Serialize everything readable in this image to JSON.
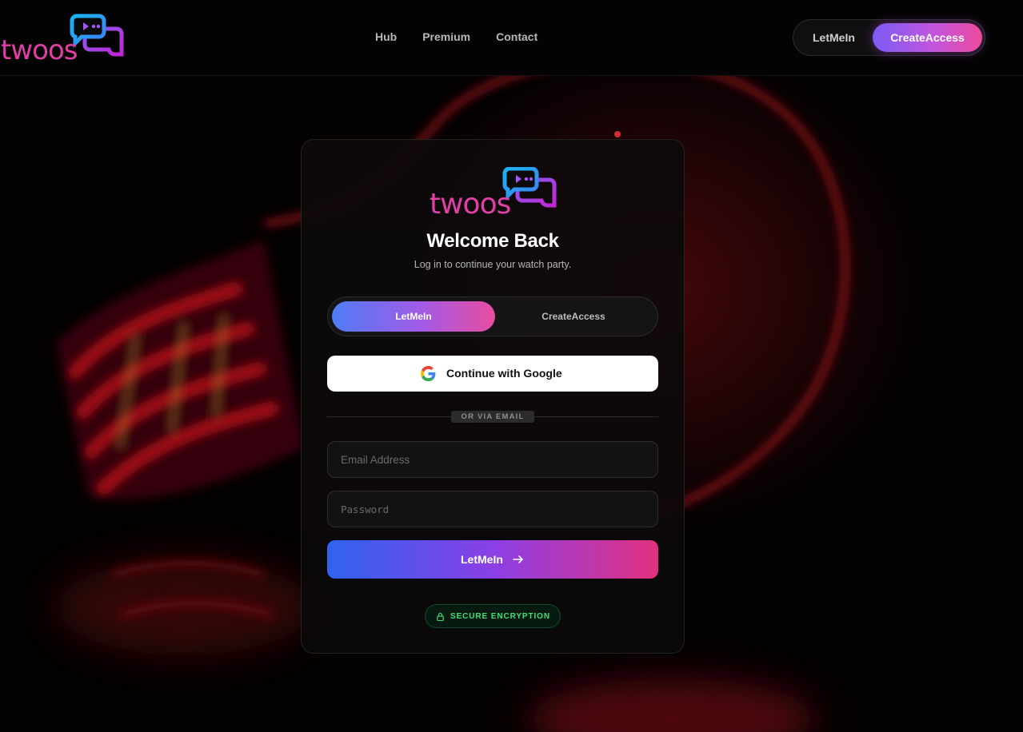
{
  "brand": {
    "name": "twoos"
  },
  "header": {
    "nav": [
      "Hub",
      "Premium",
      "Contact"
    ],
    "login_label": "LetMeIn",
    "signup_label": "CreateAccess"
  },
  "card": {
    "title": "Welcome Back",
    "subtitle": "Log in to continue your watch party.",
    "tabs": {
      "active": "LetMeIn",
      "inactive": "CreateAccess"
    },
    "google_label": "Continue with Google",
    "divider": "OR VIA EMAIL",
    "email_placeholder": "Email Address",
    "password_placeholder": "Password",
    "submit_label": "LetMeIn",
    "secure_label": "SECURE ENCRYPTION"
  },
  "icons": {
    "logo": "chat-bubbles-logo-icon",
    "google": "google-icon",
    "submit": "arrow-right-icon",
    "secure": "lock-icon"
  },
  "colors": {
    "background": "#050203",
    "accent_blue": "#2f63ef",
    "accent_purple": "#8b3fe6",
    "accent_pink": "#e2317f",
    "logo_pink": "#e03fa6",
    "secure_green": "#3ee07a"
  }
}
